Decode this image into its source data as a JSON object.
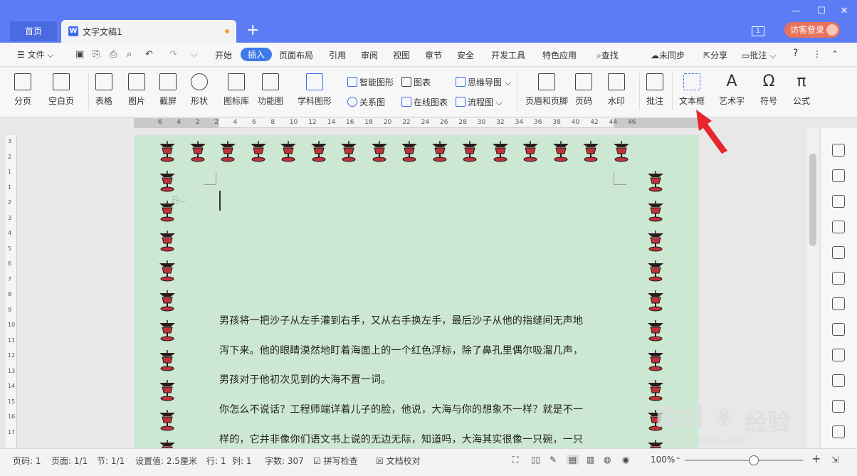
{
  "titlebar": {
    "tab_home": "首页",
    "tab_doc": "文字文稿1",
    "tab_add": "+",
    "page_indicator": "1",
    "login": "访客登录"
  },
  "menubar": {
    "file": "文件",
    "items": [
      "开始",
      "插入",
      "页面布局",
      "引用",
      "审阅",
      "视图",
      "章节",
      "安全",
      "开发工具",
      "特色应用",
      "查找"
    ],
    "active": "插入",
    "right": [
      "未同步",
      "分享",
      "批注"
    ],
    "help": "?"
  },
  "toolbar": {
    "big": [
      "分页",
      "空白页",
      "表格",
      "图片",
      "截屏",
      "形状",
      "图标库",
      "功能图",
      "学科图形",
      "页眉和页脚",
      "页码",
      "水印",
      "批注",
      "文本框",
      "艺术字",
      "符号",
      "公式"
    ],
    "small": [
      "智能图形",
      "图表",
      "思维导图",
      "关系图",
      "在线图表",
      "流程图"
    ]
  },
  "ruler": {
    "numbers": [
      "6",
      "4",
      "2",
      "2",
      "4",
      "6",
      "8",
      "10",
      "12",
      "14",
      "16",
      "18",
      "20",
      "22",
      "24",
      "26",
      "28",
      "30",
      "32",
      "34",
      "36",
      "38",
      "40",
      "42",
      "44",
      "46"
    ]
  },
  "vruler": {
    "numbers": [
      "3",
      "2",
      "1",
      "1",
      "2",
      "3",
      "4",
      "5",
      "6",
      "7",
      "8",
      "9",
      "10",
      "11",
      "12",
      "13",
      "14",
      "15",
      "16",
      "17"
    ]
  },
  "document": {
    "paragraphs": [
      "男孩将一把沙子从左手灌到右手，又从右手换左手，最后沙子从他的指缝间无声地",
      "泻下来。他的眼睛漠然地盯着海面上的一个红色浮标，除了鼻孔里偶尔吸溜几声，",
      "男孩对于他初次见到的大海不置一词。",
      "你怎么不说话？工程师端详着儿子的脸，他说，大海与你的想象不一样？就是不一",
      "样的，它并非像你们语文书上说的无边无际，知道吗，大海其实很像一只碗，一只"
    ]
  },
  "statusbar": {
    "page_code": "页码: 1",
    "page": "页面: 1/1",
    "section": "节: 1/1",
    "setting": "设置值: 2.5厘米",
    "row": "行: 1",
    "col": "列: 1",
    "words": "字数: 307",
    "spell": "拼写检查",
    "proof": "文档校对",
    "zoom": "100%",
    "minus": "-",
    "plus": "+"
  },
  "watermark": {
    "main": "Bai",
    "cn": "经验",
    "sub": "jingyan.baidu.com"
  },
  "colors": {
    "titlebar": "#5b7cf4",
    "page_bg": "#cde8d2",
    "accent": "#3f7be8",
    "arrow": "#e8242c",
    "login": "#e8735c"
  }
}
